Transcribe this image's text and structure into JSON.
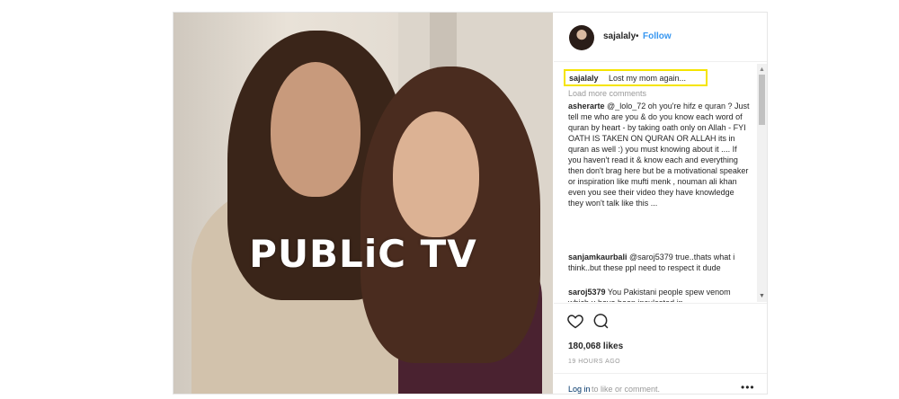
{
  "post": {
    "watermark": "PUBLiC TV",
    "header": {
      "username": "sajalaly",
      "separator": "•",
      "follow": "Follow"
    },
    "caption": {
      "username": "sajalaly",
      "text": "Lost my mom again..."
    },
    "load_more": "Load more comments",
    "comments": [
      {
        "username": "asherarte",
        "text": "@_lolo_72 oh you're hifz e quran ? Just tell me who are you & do you know each word of quran by heart - by taking oath only on Allah - FYI OATH IS TAKEN ON QURAN OR ALLAH its in quran as well :) you must knowing about it .... If you haven't read it & know each and everything then don't brag here but be a motivational speaker or inspiration like mufti menk , nouman ali khan even you see their video they have knowledge they won't talk like this ..."
      },
      {
        "username": "sanjamkaurbali",
        "text": "@saroj5379 true..thats what i think..but these ppl need to respect it dude"
      },
      {
        "username": "saroj5379",
        "text": "You Pakistani people spew venom which u have been inculcated in"
      }
    ],
    "likes": "180,068 likes",
    "time": "19 HOURS AGO",
    "login": {
      "link": "Log in",
      "text": "to like or comment."
    },
    "more": "•••"
  },
  "icons": {
    "like": "heart-icon",
    "comment": "comment-bubble-icon",
    "more": "more-options-icon"
  },
  "colors": {
    "link_blue": "#3897f0",
    "highlight": "#f5e400",
    "text": "#262626",
    "muted": "#999999"
  }
}
